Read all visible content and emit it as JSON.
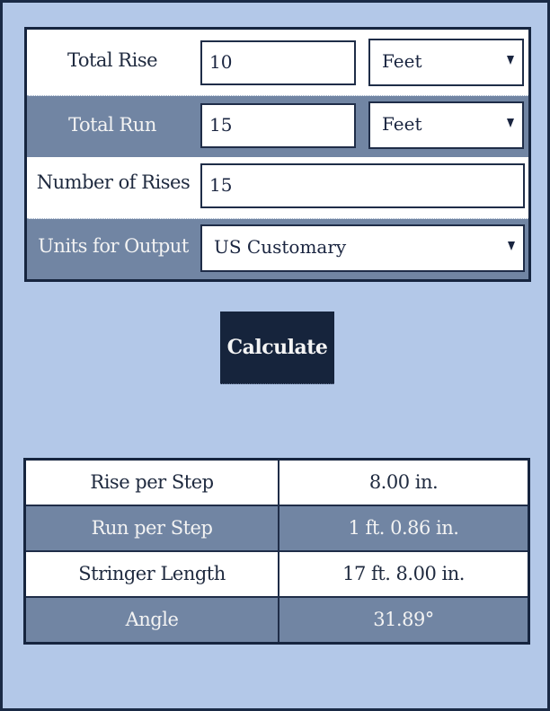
{
  "form": {
    "rows": [
      {
        "label": "Total Rise",
        "value": "10",
        "unit": "Feet"
      },
      {
        "label": "Total Run",
        "value": "15",
        "unit": "Feet"
      },
      {
        "label": "Number of Rises",
        "value": "15"
      },
      {
        "label": "Units for Output",
        "selected": "US Customary"
      }
    ]
  },
  "calculate_label": "Calculate",
  "results": {
    "rows": [
      {
        "name": "Rise per Step",
        "value": "8.00 in."
      },
      {
        "name": "Run per Step",
        "value": "1 ft. 0.86 in."
      },
      {
        "name": "Stringer Length",
        "value": "17 ft. 8.00 in."
      },
      {
        "name": "Angle",
        "value": "31.89°"
      }
    ]
  },
  "colors": {
    "background": "#b3c8e8",
    "row_dark": "#7185a3",
    "button": "#16243c",
    "border": "#16253f"
  }
}
